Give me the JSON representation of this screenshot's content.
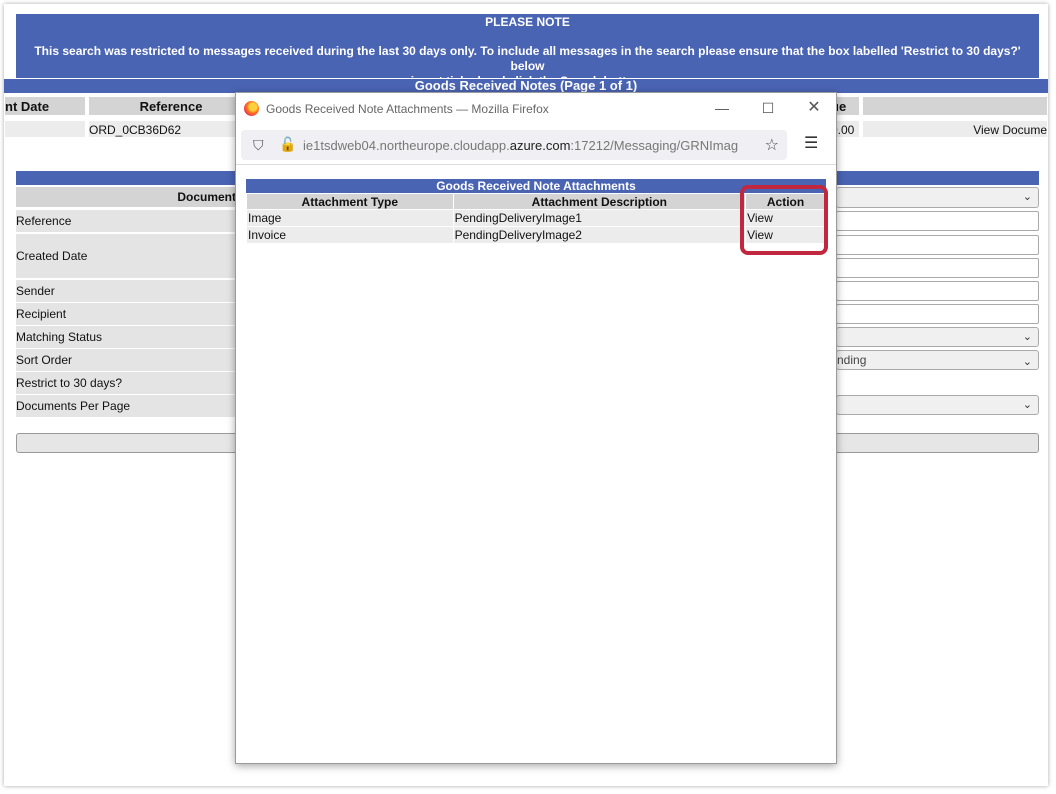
{
  "background": {
    "note_title": "PLEASE NOTE",
    "note_line1": "This search was restricted to messages received during the last 30 days only. To include all messages in the search please ensure that the box labelled 'Restrict to 30 days?' below",
    "note_line2": "is not ticked and click the Search button.",
    "grn_title": "Goods Received Notes (Page 1 of 1)",
    "columns": [
      "nt Date",
      "Reference",
      "ue"
    ],
    "row_reference": "ORD_0CB36D62",
    "row_value_fragment": "0.00",
    "row_action": "View Docume",
    "document_label": "Document",
    "fields": [
      "Reference",
      "Created Date",
      "Sender",
      "Recipient",
      "Matching Status",
      "Sort Order",
      "Restrict to 30 days?",
      "Documents Per Page"
    ],
    "sort_order_value": "nding"
  },
  "popup": {
    "window_title": "Goods Received Note Attachments — Mozilla Firefox",
    "url_prefix": "ie1tsdweb04.northeurope.cloudapp.",
    "url_domain": "azure.com",
    "url_suffix": ":17212/Messaging/GRNImag",
    "table_title": "Goods Received Note Attachments",
    "headers": [
      "Attachment Type",
      "Attachment Description",
      "Action"
    ],
    "rows": [
      {
        "type": "Image",
        "description": "PendingDeliveryImage1",
        "action": "View"
      },
      {
        "type": "Invoice",
        "description": "PendingDeliveryImage2",
        "action": "View"
      }
    ]
  },
  "colors": {
    "header_blue": "#4a64b4",
    "highlight_red": "#c1273f"
  }
}
